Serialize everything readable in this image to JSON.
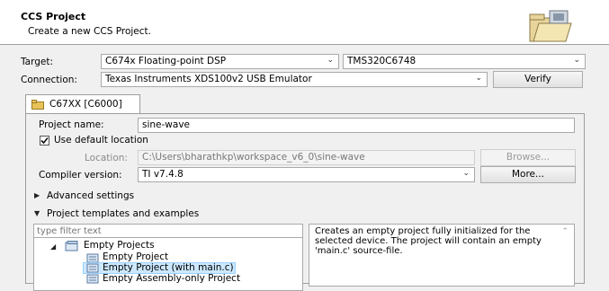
{
  "header": {
    "title": "CCS Project",
    "subtitle": "Create a new CCS Project.",
    "icon": "folder-wizard-icon"
  },
  "target": {
    "label": "Target:",
    "family_value": "C674x Floating-point DSP",
    "device_value": "TMS320C6748"
  },
  "connection": {
    "label": "Connection:",
    "value": "Texas Instruments XDS100v2 USB Emulator",
    "verify_label": "Verify"
  },
  "tab": {
    "label": "C67XX [C6000]"
  },
  "project": {
    "name_label": "Project name:",
    "name_value": "sine-wave",
    "use_default_label": "Use default location",
    "use_default_checked": true,
    "location_label": "Location:",
    "location_value": "C:\\Users\\bharathkp\\workspace_v6_0\\sine-wave",
    "browse_label": "Browse...",
    "compiler_label": "Compiler version:",
    "compiler_value": "TI v7.4.8",
    "more_label": "More..."
  },
  "sections": {
    "advanced": "Advanced settings",
    "templates": "Project templates and examples"
  },
  "templates": {
    "filter_placeholder": "type filter text",
    "group": "Empty Projects",
    "items": [
      "Empty Project",
      "Empty Project (with main.c)",
      "Empty Assembly-only Project"
    ],
    "selected_index": 1,
    "description": "Creates an empty project fully initialized for the selected device. The project will contain an empty 'main.c' source-file."
  }
}
